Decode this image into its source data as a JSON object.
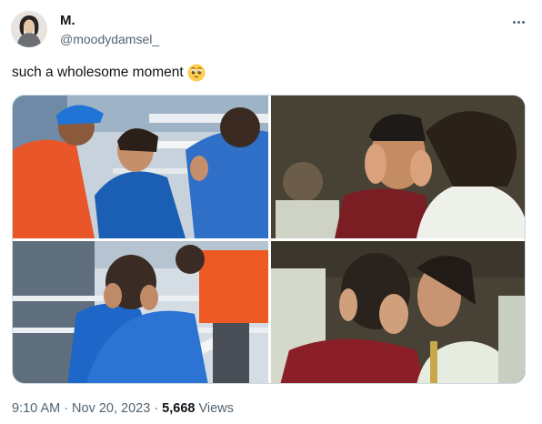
{
  "author": {
    "display_name": "M.",
    "handle": "@moodydamsel_",
    "avatar_icon": "profile-photo"
  },
  "tweet": {
    "text": "such a wholesome moment",
    "emoji": "pleading-face-emoji"
  },
  "media": {
    "photos": [
      {
        "name": "photo-stadium-hug"
      },
      {
        "name": "photo-film-scene-boy"
      },
      {
        "name": "photo-stadium-face-hold"
      },
      {
        "name": "photo-film-scene-kiss"
      }
    ]
  },
  "meta": {
    "time": "9:10 AM",
    "separator": "·",
    "date": "Nov 20, 2023",
    "separator2": "·",
    "views_count": "5,668",
    "views_label": "Views"
  },
  "colors": {
    "text_primary": "#0f1419",
    "text_secondary": "#536471",
    "border": "#cfd9de",
    "jersey_blue": "#1f6fd1",
    "jersey_orange": "#ee5a24"
  }
}
